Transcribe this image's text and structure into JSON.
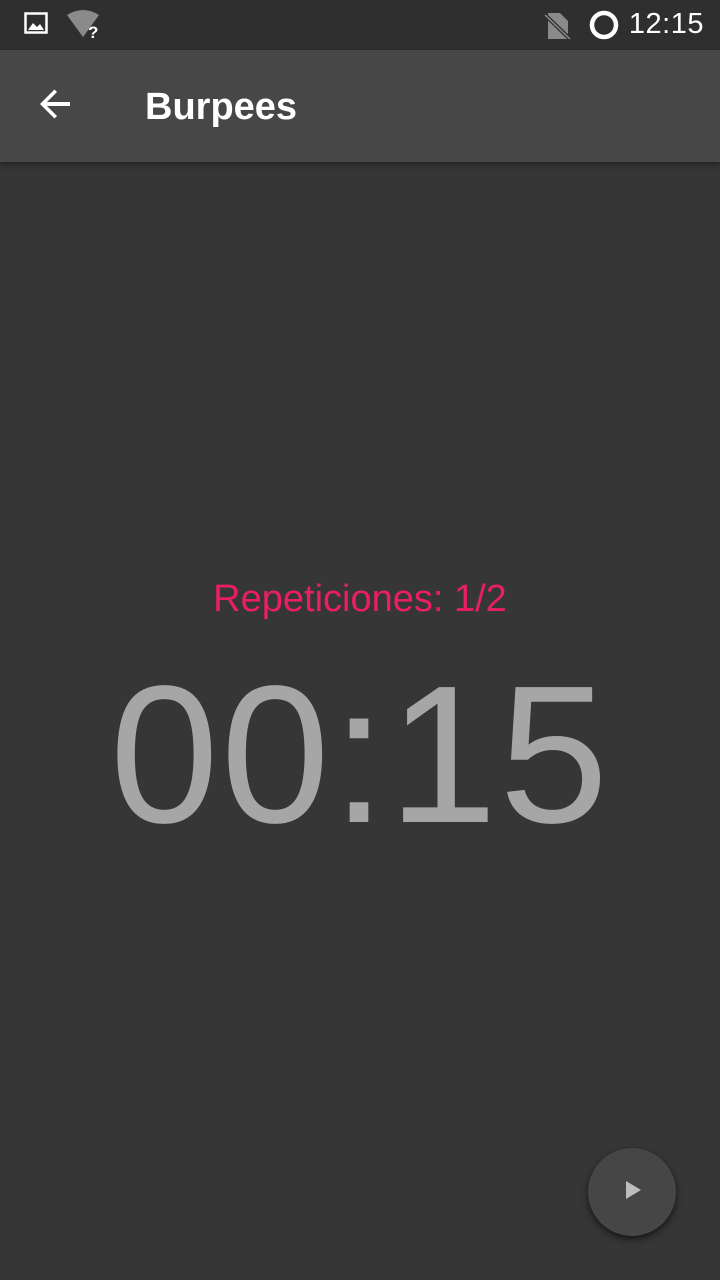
{
  "status_bar": {
    "time": "12:15",
    "icons": [
      "image-notification-icon",
      "wifi-unknown-icon",
      "no-sim-icon",
      "sync-circle-icon"
    ]
  },
  "toolbar": {
    "title": "Burpees",
    "back_icon": "arrow-back-icon"
  },
  "main": {
    "reps_label": "Repeticiones: 1/2",
    "timer": "00:15"
  },
  "fab": {
    "icon": "play-icon"
  },
  "colors": {
    "background": "#363636",
    "toolbar": "#474747",
    "status_bar": "#2f2f2f",
    "accent": "#e91e63",
    "timer_text": "#a6a6a6"
  }
}
